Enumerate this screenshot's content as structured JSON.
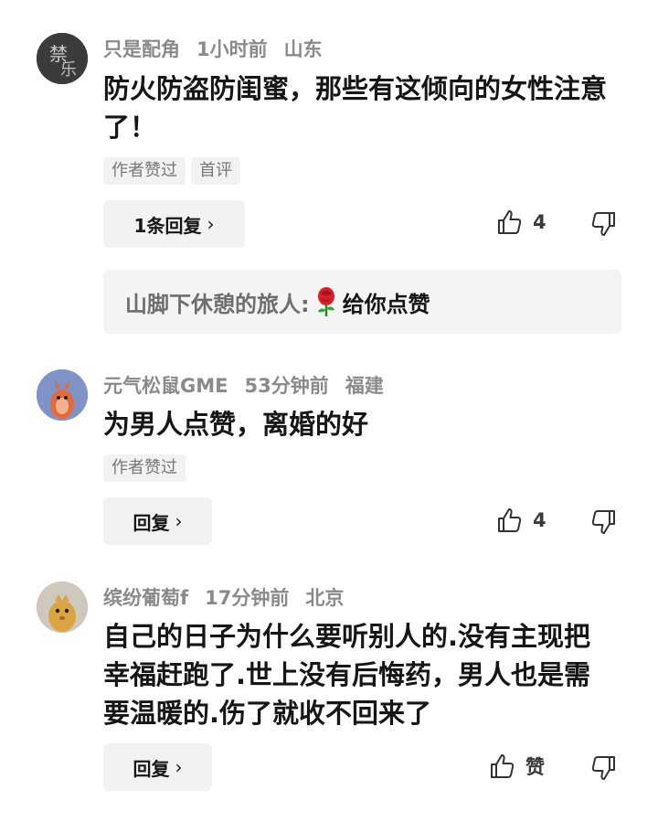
{
  "comments": [
    {
      "username": "只是配角",
      "time": "1小时前",
      "location": "山东",
      "text": "防火防盗防闺蜜，那些有这倾向的女性注意了！",
      "tags": [
        "作者赞过",
        "首评"
      ],
      "reply_label": "1条回复",
      "likes": "4",
      "sub_reply": {
        "name": "山脚下休憩的旅人:",
        "text": "给你点赞"
      }
    },
    {
      "username": "元气松鼠GME",
      "time": "53分钟前",
      "location": "福建",
      "text": "为男人点赞，离婚的好",
      "tags": [
        "作者赞过"
      ],
      "reply_label": "回复",
      "likes": "4"
    },
    {
      "username": "缤纷葡萄f",
      "time": "17分钟前",
      "location": "北京",
      "text": "自己的日子为什么要听别人的.没有主现把幸福赶跑了.世上没有后悔药，男人也是需要温暖的.伤了就收不回来了",
      "reply_label": "回复",
      "likes": "赞"
    }
  ],
  "icons": {
    "like": "thumbs-up-icon",
    "dislike": "thumbs-down-icon",
    "chevron": "chevron-right-icon",
    "rose": "rose-emoji-icon"
  }
}
